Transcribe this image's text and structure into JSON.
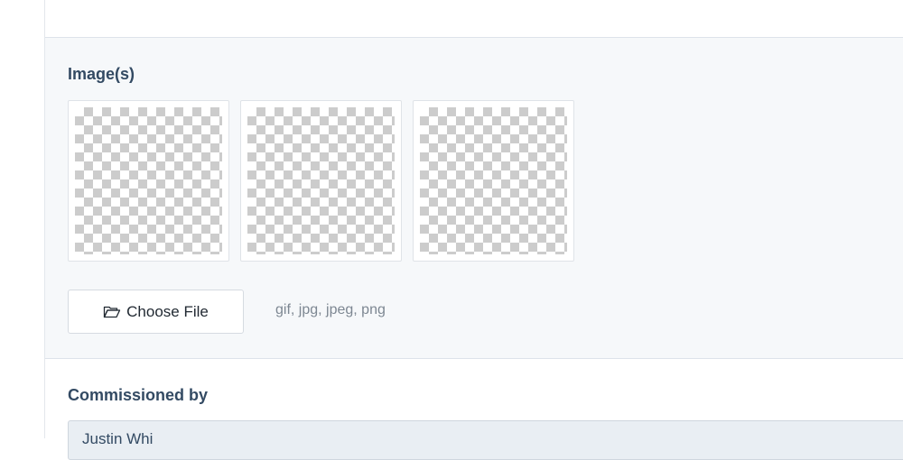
{
  "images_section": {
    "title": "Image(s)",
    "thumbnails": [
      {
        "icon": "transparent-checkerboard-image"
      },
      {
        "icon": "transparent-checkerboard-image"
      },
      {
        "icon": "transparent-checkerboard-image"
      }
    ],
    "choose_file_label": "Choose File",
    "choose_file_icon": "folder-open-icon",
    "allowed_types": "gif, jpg, jpeg, png"
  },
  "commissioned_section": {
    "title": "Commissioned by",
    "value": "Justin    Whi"
  },
  "colors": {
    "panel_bg": "#f6f8fa",
    "title_text": "#334a63",
    "border": "#dde3ea",
    "muted_text": "#7d8792"
  }
}
